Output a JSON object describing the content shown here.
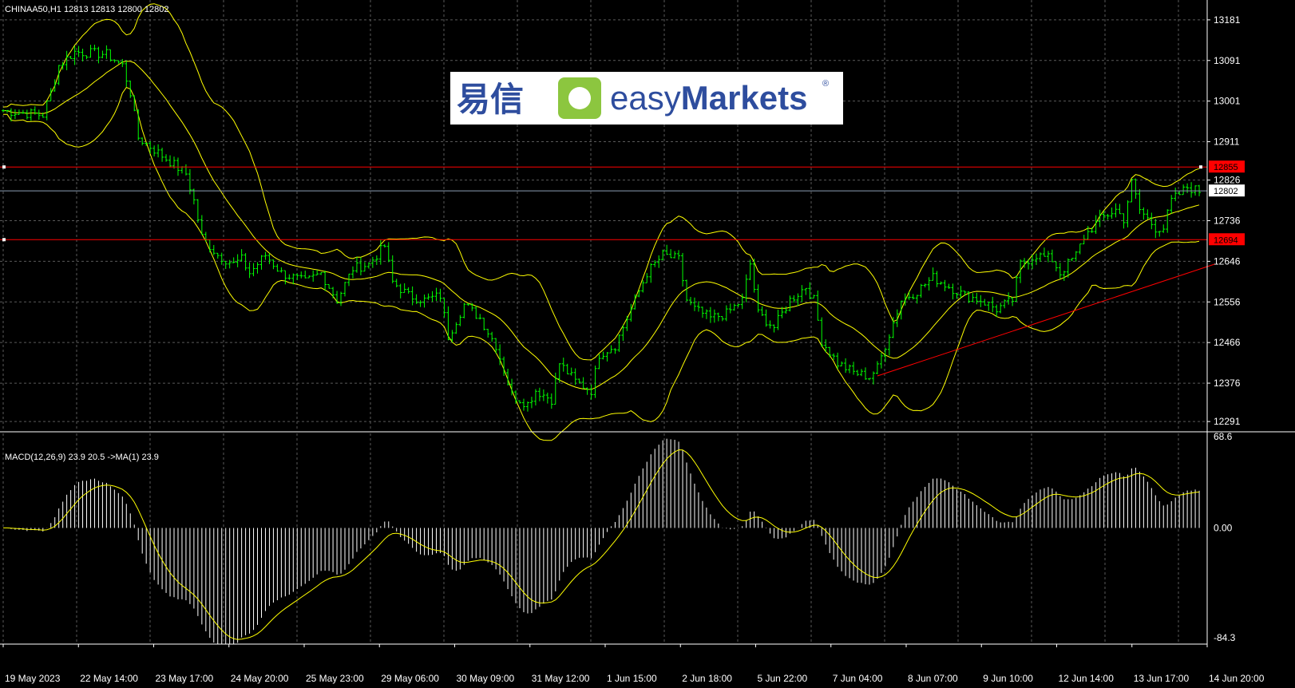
{
  "header": {
    "symbol_info": "CHINAA50,H1  12813 12813 12800 12802",
    "macd_info": "MACD(12,26,9) 23.9 20.5  ->MA(1) 23.9"
  },
  "logo": {
    "chinese_text": "易信",
    "brand_easy": "easy",
    "brand_markets": "Markets",
    "registered": "®"
  },
  "colors": {
    "background": "#000000",
    "grid": "#5a5a5a",
    "candles": "#00ff00",
    "bands": "#ffff00",
    "level_lines": "#ff0000",
    "trendline": "#ff0000",
    "macd_hist": "#ffffff",
    "macd_signal": "#ffff00",
    "bid_line": "#8c9eb4"
  },
  "chart_data": [
    {
      "type": "line",
      "title": "CHINAA50,H1",
      "ylim": [
        12270,
        13225
      ],
      "price_ticks": [
        "13181",
        "13091",
        "13001",
        "12911",
        "12826",
        "12736",
        "12646",
        "12556",
        "12466",
        "12376",
        "12291"
      ],
      "time_labels": [
        "19 May 2023",
        "22 May 14:00",
        "23 May 17:00",
        "24 May 20:00",
        "25 May 23:00",
        "29 May 06:00",
        "30 May 09:00",
        "31 May 12:00",
        "1 Jun 15:00",
        "2 Jun 18:00",
        "5 Jun 22:00",
        "7 Jun 04:00",
        "8 Jun 07:00",
        "9 Jun 10:00",
        "12 Jun 14:00",
        "13 Jun 17:00",
        "14 Jun 20:00"
      ],
      "close_anchors": [
        [
          0,
          12980
        ],
        [
          10,
          12970
        ],
        [
          12,
          13020
        ],
        [
          14,
          13080
        ],
        [
          18,
          13110
        ],
        [
          26,
          13105
        ],
        [
          30,
          13080
        ],
        [
          32,
          13020
        ],
        [
          34,
          12920
        ],
        [
          40,
          12880
        ],
        [
          46,
          12840
        ],
        [
          48,
          12780
        ],
        [
          50,
          12700
        ],
        [
          54,
          12660
        ],
        [
          58,
          12640
        ],
        [
          60,
          12650
        ],
        [
          62,
          12620
        ],
        [
          66,
          12660
        ],
        [
          70,
          12620
        ],
        [
          76,
          12600
        ],
        [
          80,
          12620
        ],
        [
          84,
          12560
        ],
        [
          88,
          12630
        ],
        [
          92,
          12640
        ],
        [
          96,
          12680
        ],
        [
          98,
          12600
        ],
        [
          102,
          12570
        ],
        [
          106,
          12560
        ],
        [
          110,
          12570
        ],
        [
          112,
          12480
        ],
        [
          116,
          12550
        ],
        [
          120,
          12520
        ],
        [
          124,
          12460
        ],
        [
          128,
          12350
        ],
        [
          132,
          12330
        ],
        [
          134,
          12360
        ],
        [
          138,
          12340
        ],
        [
          140,
          12420
        ],
        [
          144,
          12380
        ],
        [
          148,
          12360
        ],
        [
          150,
          12440
        ],
        [
          154,
          12460
        ],
        [
          158,
          12540
        ],
        [
          162,
          12620
        ],
        [
          166,
          12660
        ],
        [
          170,
          12650
        ],
        [
          172,
          12560
        ],
        [
          174,
          12540
        ],
        [
          178,
          12520
        ],
        [
          182,
          12530
        ],
        [
          186,
          12560
        ],
        [
          188,
          12640
        ],
        [
          190,
          12530
        ],
        [
          194,
          12500
        ],
        [
          198,
          12560
        ],
        [
          202,
          12590
        ],
        [
          204,
          12560
        ],
        [
          206,
          12470
        ],
        [
          210,
          12420
        ],
        [
          214,
          12400
        ],
        [
          218,
          12390
        ],
        [
          220,
          12410
        ],
        [
          222,
          12460
        ],
        [
          226,
          12560
        ],
        [
          230,
          12580
        ],
        [
          234,
          12610
        ],
        [
          238,
          12590
        ],
        [
          242,
          12570
        ],
        [
          246,
          12560
        ],
        [
          250,
          12540
        ],
        [
          254,
          12560
        ],
        [
          256,
          12640
        ],
        [
          260,
          12660
        ],
        [
          264,
          12650
        ],
        [
          266,
          12620
        ],
        [
          270,
          12660
        ],
        [
          272,
          12700
        ],
        [
          276,
          12740
        ],
        [
          280,
          12760
        ],
        [
          282,
          12740
        ],
        [
          284,
          12820
        ],
        [
          286,
          12760
        ],
        [
          290,
          12720
        ],
        [
          292,
          12720
        ],
        [
          294,
          12780
        ],
        [
          298,
          12810
        ],
        [
          301,
          12802
        ]
      ],
      "bands_period": 20,
      "bands_deviation": 2,
      "levels": [
        {
          "price": 12855,
          "label": "12855"
        },
        {
          "price": 12694,
          "label": "12694"
        }
      ],
      "bid": {
        "price": 12802,
        "label": "12802"
      },
      "trendline": {
        "from_bar": 220,
        "from_price": 12392,
        "to_bar": 305,
        "to_price": 12640
      }
    },
    {
      "type": "bar",
      "title": "MACD(12,26,9)",
      "ylim": [
        -84.3,
        68.6
      ],
      "ticks": [
        "68.6",
        "0.00",
        "-84.3"
      ],
      "fast": 12,
      "slow": 26,
      "signal": 9
    }
  ]
}
